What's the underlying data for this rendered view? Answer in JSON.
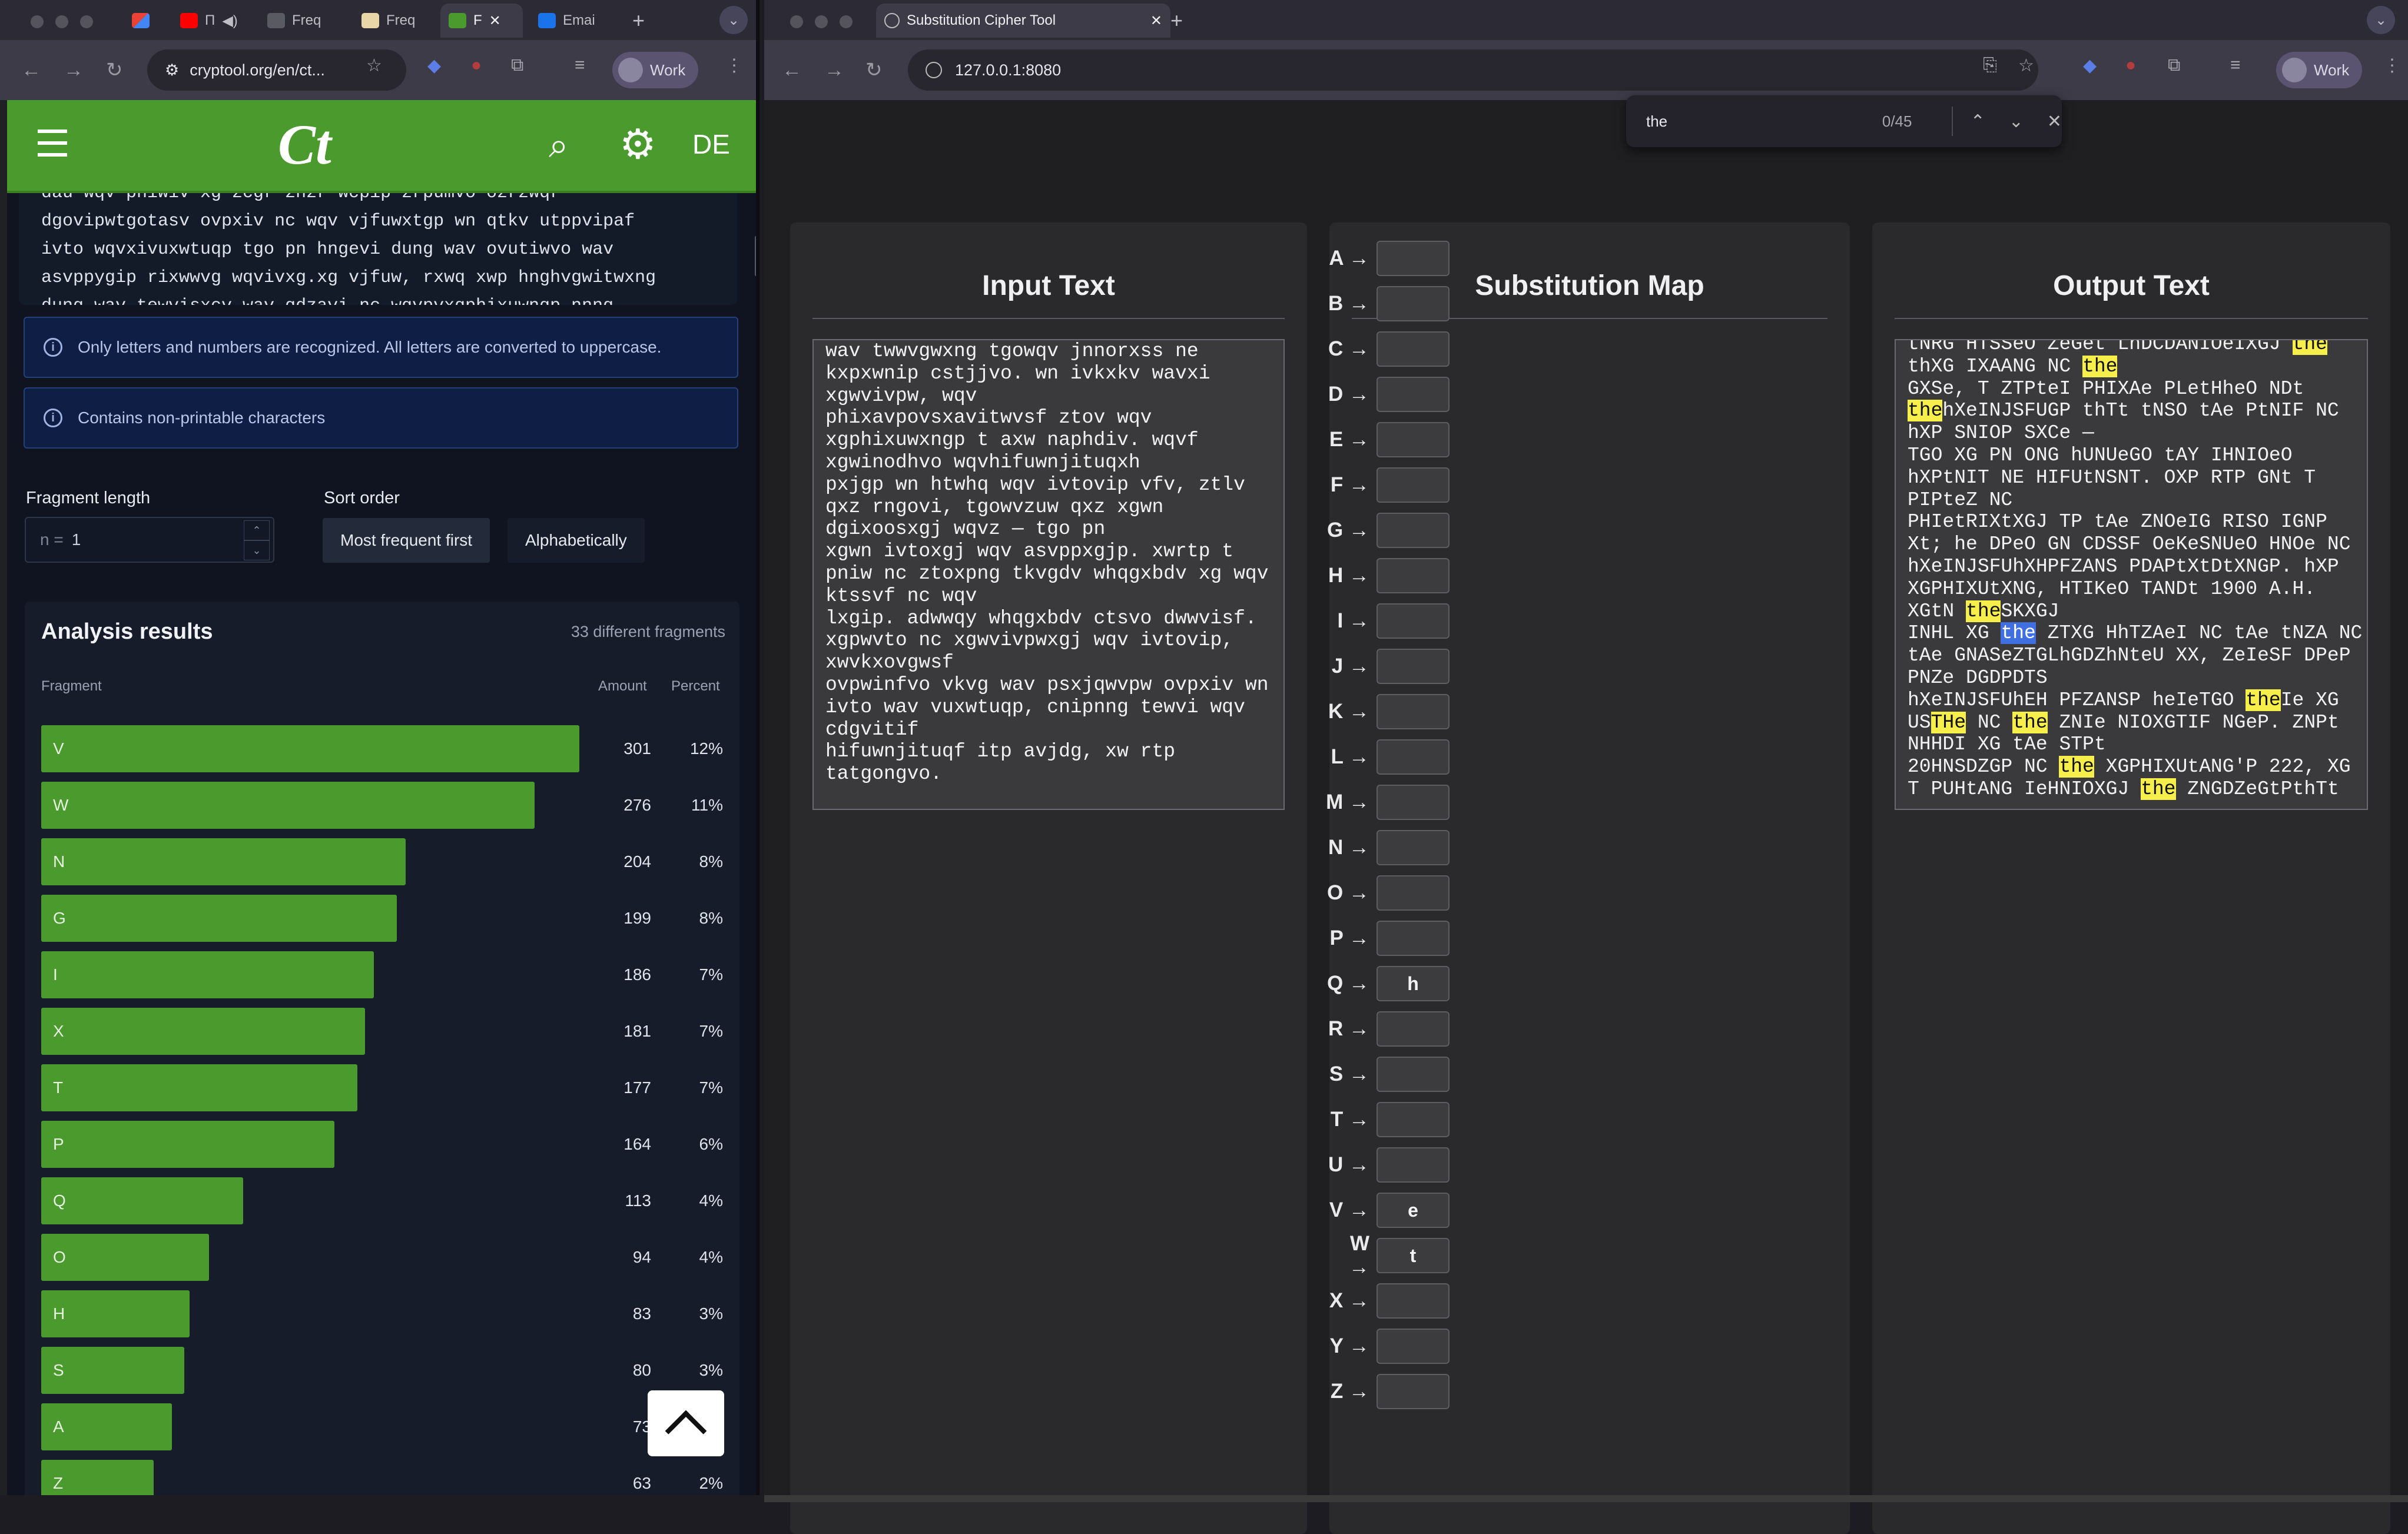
{
  "left_browser": {
    "tabs": [
      "Freq",
      "Freq",
      "F",
      "Emai"
    ],
    "tab_mute": "Π",
    "omnibox": "cryptool.org/en/ct...",
    "profile": "Work",
    "header": {
      "logo": "Ct",
      "lang": "DE"
    },
    "ciphertext_lines": [
      "dau wqv pniwiv xg zcgr znzr wcpip zrpumvo ozrzwqr",
      "dgovipwtgotasv ovpxiv nc wqv vjfuwxtgp wn qtkv utppvipaf",
      "ivto wqvxivuxwtuqp tgo pn hngevi dung wav ovutiwvo wav",
      "asvppygip rixwwvg wqvivxg.xg vjfuw, rxwq xwp hnghvgwitwxng",
      "dung wav tewvisxcv  wav qdzavi nc wqvpvxqphixuwnqp nnnq ."
    ],
    "alerts": [
      "Only letters and numbers are recognized. All letters are converted to uppercase.",
      "Contains non-printable characters"
    ],
    "fragment_length": {
      "label": "Fragment length",
      "prefix": "n =",
      "value": "1"
    },
    "sort_order": {
      "label": "Sort order",
      "options": [
        "Most frequent first",
        "Alphabetically"
      ],
      "selected": "Most frequent first"
    },
    "results": {
      "title": "Analysis results",
      "count_text": "33 different fragments",
      "col_fragment": "Fragment",
      "col_amount": "Amount",
      "col_percent": "Percent",
      "rows": [
        {
          "f": "V",
          "a": "301",
          "p": "12%"
        },
        {
          "f": "W",
          "a": "276",
          "p": "11%"
        },
        {
          "f": "N",
          "a": "204",
          "p": "8%"
        },
        {
          "f": "G",
          "a": "199",
          "p": "8%"
        },
        {
          "f": "I",
          "a": "186",
          "p": "7%"
        },
        {
          "f": "X",
          "a": "181",
          "p": "7%"
        },
        {
          "f": "T",
          "a": "177",
          "p": "7%"
        },
        {
          "f": "P",
          "a": "164",
          "p": "6%"
        },
        {
          "f": "Q",
          "a": "113",
          "p": "4%"
        },
        {
          "f": "O",
          "a": "94",
          "p": "4%"
        },
        {
          "f": "H",
          "a": "83",
          "p": "3%"
        },
        {
          "f": "S",
          "a": "80",
          "p": "3%"
        },
        {
          "f": "A",
          "a": "73",
          "p": "3%"
        },
        {
          "f": "Z",
          "a": "63",
          "p": "2%"
        }
      ]
    }
  },
  "right_browser": {
    "tab_title": "Substitution Cipher Tool",
    "omnibox": "127.0.0.1:8080",
    "profile": "Work",
    "find": {
      "query": "the",
      "count": "0/45"
    },
    "input": {
      "title": "Input Text",
      "lines": [
        "wav twwvgwxng tgowqv jnnorxss ne",
        "kxpxwnip cstjjvo. wn ivkxkv wavxi",
        "xgwvivpw, wqv",
        "phixavpovsxavitwvsf ztov wqv",
        "xgphixuwxngp t axw naphdiv. wqvf",
        "xgwinodhvo wqvhifuwnjituqxh",
        "pxjgp wn htwhq wqv ivtovip vfv, ztlv",
        "qxz rngovi, tgowvzuw qxz xgwn",
        "dgixoosxgj wqvz — tgo pn",
        "xgwn ivtoxgj wqv asvppxgjp. xwrtp t",
        "pniw nc ztoxpng tkvgdv whqgxbdv xg wqv",
        "ktssvf nc wqv",
        "lxgip. adwwqy whqgxbdv ctsvo dwwvisf.",
        "xgpwvto nc xgwvivpwxgj wqv ivtovip,",
        "xwvkxovgwsf",
        "ovpwinfvo vkvg wav psxjqwvpw ovpxiv wn",
        "ivto wav vuxwtuqp, cnipnng tewvi wqv",
        "cdgvitif",
        "hifuwnjituqf itp avjdg, xw rtp",
        "tatgongvo."
      ]
    },
    "map": {
      "title": "Substitution Map",
      "rows": [
        {
          "l": "A",
          "v": ""
        },
        {
          "l": "B",
          "v": ""
        },
        {
          "l": "C",
          "v": ""
        },
        {
          "l": "D",
          "v": ""
        },
        {
          "l": "E",
          "v": ""
        },
        {
          "l": "F",
          "v": ""
        },
        {
          "l": "G",
          "v": ""
        },
        {
          "l": "H",
          "v": ""
        },
        {
          "l": "I",
          "v": ""
        },
        {
          "l": "J",
          "v": ""
        },
        {
          "l": "K",
          "v": ""
        },
        {
          "l": "L",
          "v": ""
        },
        {
          "l": "M",
          "v": ""
        },
        {
          "l": "N",
          "v": ""
        },
        {
          "l": "O",
          "v": ""
        },
        {
          "l": "P",
          "v": ""
        },
        {
          "l": "Q",
          "v": "h"
        },
        {
          "l": "R",
          "v": ""
        },
        {
          "l": "S",
          "v": ""
        },
        {
          "l": "T",
          "v": ""
        },
        {
          "l": "U",
          "v": ""
        },
        {
          "l": "V",
          "v": "e"
        },
        {
          "l": "W",
          "v": "t"
        },
        {
          "l": "X",
          "v": ""
        },
        {
          "l": "Y",
          "v": ""
        },
        {
          "l": "Z",
          "v": ""
        }
      ]
    },
    "output": {
      "title": "Output Text",
      "lines": [
        [
          [
            "tNRG HTSSeO ZeGet LhDCDANIOeIXGJ ",
            ""
          ],
          [
            "the",
            "hl"
          ]
        ],
        [
          [
            "thXG IXAANG NC ",
            ""
          ],
          [
            "the",
            "hl"
          ]
        ],
        [
          [
            "GXSe, T ZTPteI PHIXAe PLetHheO NDt",
            ""
          ]
        ],
        [
          [
            "the",
            "hl"
          ],
          [
            "hXeINJSFUGP thTt tNSO tAe PtNIF NC",
            ""
          ]
        ],
        [
          [
            "hXP SNIOP SXCe —",
            ""
          ]
        ],
        [
          [
            "TGO XG PN ONG hUNUeGO tAY IHNIOeO",
            ""
          ]
        ],
        [
          [
            "hXPtNIT NE HIFUtNSNT. OXP RTP GNt T",
            ""
          ]
        ],
        [
          [
            "PIPteZ NC",
            ""
          ]
        ],
        [
          [
            "PHIetRIXtXGJ TP tAe ZNOeIG RISO IGNP",
            ""
          ]
        ],
        [
          [
            "Xt; he DPeO GN CDSSF OeKeSNUeO HNOe NC",
            ""
          ]
        ],
        [
          [
            "hXeINJSFUhXHPFZANS PDAPtXtDtXNGP. hXP",
            ""
          ]
        ],
        [
          [
            "XGPHIXUtXNG, HTIKeO TANDt 1900 A.H.",
            ""
          ]
        ],
        [
          [
            "XGtN ",
            ""
          ],
          [
            "the",
            "hl"
          ],
          [
            "SKXGJ",
            ""
          ]
        ],
        [
          [
            "INHL XG ",
            ""
          ],
          [
            "the",
            "hlc"
          ],
          [
            " ZTXG HhTZAeI NC tAe tNZA NC",
            ""
          ]
        ],
        [
          [
            "tAe GNASeZTGLhGDZhNteU XX, ZeIeSF DPeP",
            ""
          ]
        ],
        [
          [
            "PNZe DGDPDTS",
            ""
          ]
        ],
        [
          [
            "hXeINJSFUhEH PFZANSP heIeTGO ",
            ""
          ],
          [
            "the",
            "hl"
          ],
          [
            "Ie XG",
            ""
          ]
        ],
        [
          [
            "US",
            ""
          ],
          [
            "THe",
            "hl"
          ],
          [
            " NC ",
            ""
          ],
          [
            "the",
            "hl"
          ],
          [
            " ZNIe NIOXGTIF NGeP. ZNPt",
            ""
          ]
        ],
        [
          [
            "NHHDI XG tAe STPt",
            ""
          ]
        ],
        [
          [
            "20HNSDZGP NC ",
            ""
          ],
          [
            "the",
            "hl"
          ],
          [
            " XGPHIXUtANG'P 222, XG",
            ""
          ]
        ],
        [
          [
            "T PUHtANG IeHNIOXGJ ",
            ""
          ],
          [
            "the",
            "hl"
          ],
          [
            " ZNGDZeGtPthTt",
            ""
          ]
        ]
      ]
    }
  },
  "colors": {
    "cryptool_green": "#4a9a2e",
    "find_highlight": "#f6ee4a",
    "find_current": "#3f6fe0"
  }
}
